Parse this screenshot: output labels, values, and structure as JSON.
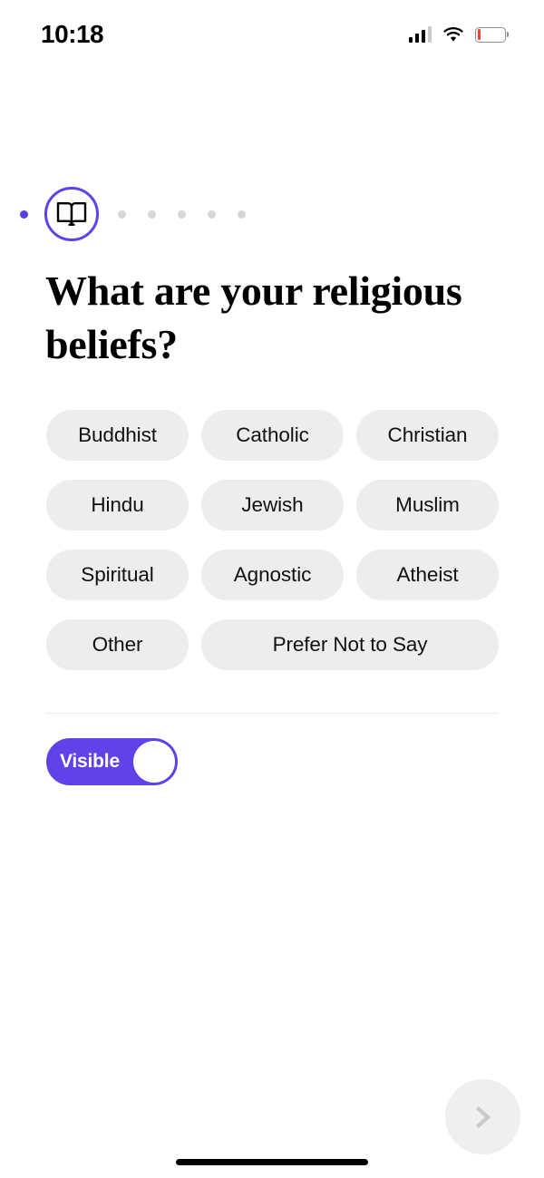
{
  "status_bar": {
    "time": "10:18",
    "signal_icon": "cellular-signal-icon",
    "wifi_icon": "wifi-icon",
    "battery_icon": "battery-low-icon",
    "battery_level_percent": 13
  },
  "stepper": {
    "current_step_icon": "open-book-icon",
    "completed_dots": 1,
    "upcoming_dots": 5,
    "active_color": "#5b3fe4",
    "inactive_color": "#d6d6d8"
  },
  "main": {
    "title": "What are your religious beliefs?",
    "options": [
      {
        "label": "Buddhist",
        "width": "narrow"
      },
      {
        "label": "Catholic",
        "width": "narrow"
      },
      {
        "label": "Christian",
        "width": "narrow"
      },
      {
        "label": "Hindu",
        "width": "narrow"
      },
      {
        "label": "Jewish",
        "width": "narrow"
      },
      {
        "label": "Muslim",
        "width": "narrow"
      },
      {
        "label": "Spiritual",
        "width": "narrow"
      },
      {
        "label": "Agnostic",
        "width": "narrow"
      },
      {
        "label": "Atheist",
        "width": "narrow"
      },
      {
        "label": "Other",
        "width": "narrow"
      },
      {
        "label": "Prefer Not to Say",
        "width": "wide"
      }
    ],
    "chip_background": "#ededed",
    "chip_text_color": "#111111"
  },
  "visibility": {
    "label": "Visible",
    "state": "on",
    "accent_color": "#6042e8"
  },
  "footer": {
    "next_icon": "chevron-right-icon",
    "next_enabled": false,
    "next_background": "#efefef",
    "next_icon_color": "#c9c9c9"
  }
}
